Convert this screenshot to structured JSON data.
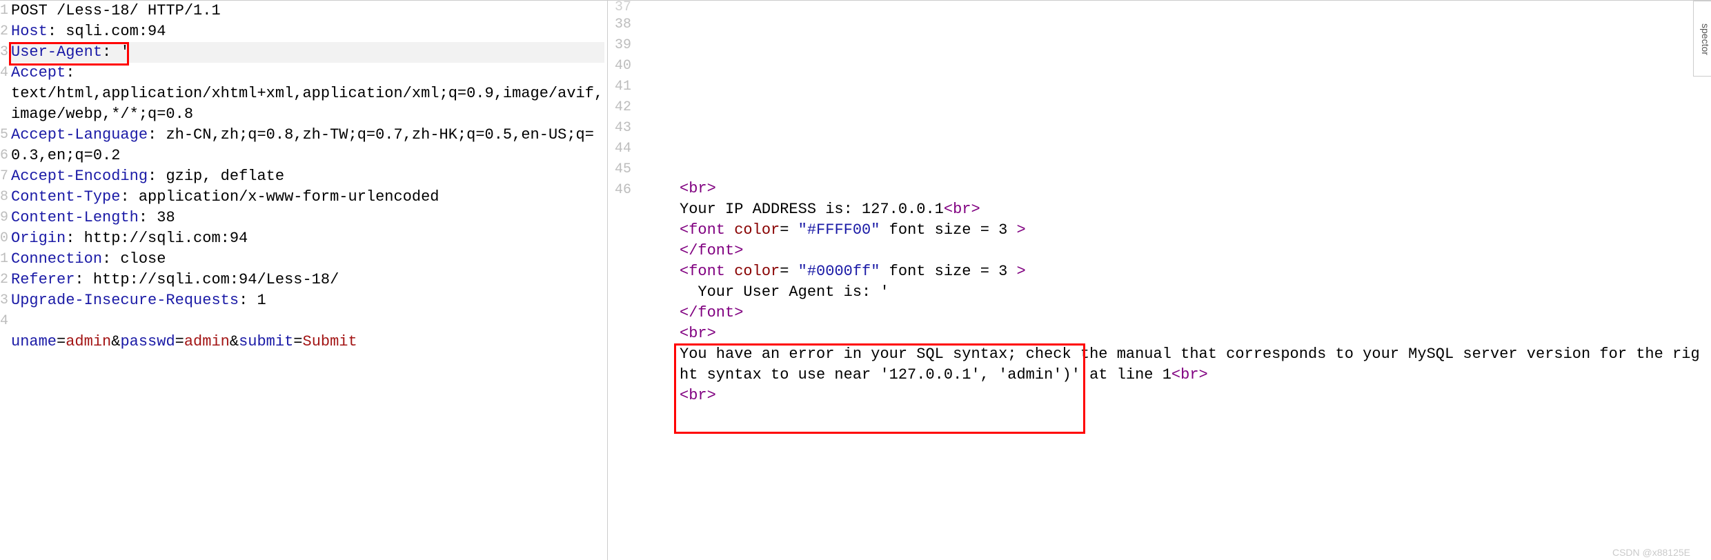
{
  "left": {
    "gutter": [
      "1",
      "2",
      "3",
      "4",
      "5",
      "6",
      "7",
      "8",
      "9",
      "0",
      "1",
      "2",
      "3",
      "4"
    ],
    "lines": {
      "l1": {
        "method": "POST",
        "path": " /Less-18/ ",
        "proto": "HTTP/1.1"
      },
      "l2": {
        "h": "Host",
        "v": " sqli.com:94"
      },
      "l3": {
        "h": "User-Agent",
        "v": " '"
      },
      "l4": {
        "h": "Accept",
        "v": ""
      },
      "l4b": "text/html,application/xhtml+xml,application/xml;q=0.9,image/avif,image/webp,*/*;q=0.8",
      "l5": {
        "h": "Accept-Language",
        "v": " zh-CN,zh;q=0.8,zh-TW;q=0.7,zh-HK;q=0.5,en-US;q=0.3,en;q=0.2"
      },
      "l6": {
        "h": "Accept-Encoding",
        "v": " gzip, deflate"
      },
      "l7": {
        "h": "Content-Type",
        "v": " application/x-www-form-urlencoded"
      },
      "l8": {
        "h": "Content-Length",
        "v": " 38"
      },
      "l9": {
        "h": "Origin",
        "v": " http://sqli.com:94"
      },
      "l10": {
        "h": "Connection",
        "v": " close"
      },
      "l11": {
        "h": "Referer",
        "v": " http://sqli.com:94/Less-18/"
      },
      "l12": {
        "h": "Upgrade-Insecure-Requests",
        "v": " 1"
      },
      "l14": {
        "p1": "uname",
        "v1": "admin",
        "amp": "&",
        "p2": "passwd",
        "v2": "admin",
        "p3": "submit",
        "v3": "Submit"
      }
    }
  },
  "right": {
    "gutter": [
      "37",
      "38",
      "39",
      "40",
      "41",
      "42",
      "43",
      "44",
      "45",
      "46"
    ],
    "lines": {
      "br": {
        "lt": "<",
        "tag": "br",
        "gt": ">"
      },
      "your_ip": {
        "pre": "Your IP ADDRESS is: 127.0.0.1",
        "lt": "<",
        "tag": "br",
        "gt": ">"
      },
      "font1_open": {
        "lt": "<",
        "tag": "font",
        "sp": " ",
        "a1": "color",
        "eq": "=",
        "sp2": " ",
        "v1": "\"#FFFF00\"",
        "mid": " font size = 3 ",
        "gt": ">"
      },
      "font_close": {
        "lt": "</",
        "tag": "font",
        "gt": ">"
      },
      "font2_open": {
        "lt": "<",
        "tag": "font",
        "sp": " ",
        "a1": "color",
        "eq": "=",
        "sp2": " ",
        "v1": "\"#0000ff\"",
        "mid": " font size = 3 ",
        "gt": ">"
      },
      "ua_text": "  Your User Agent is: '",
      "err_text": "You have an error in your SQL syntax; check the manual that corresponds to your MySQL server version for the right syntax to use near '127.0.0.1', 'admin')' at line 1",
      "br2": {
        "lt": "<",
        "tag": "br",
        "gt": ">"
      },
      "br3": {
        "lt": "<",
        "tag": "br",
        "gt": ">"
      }
    },
    "tab": "spector"
  },
  "watermark": "CSDN @x88125E"
}
